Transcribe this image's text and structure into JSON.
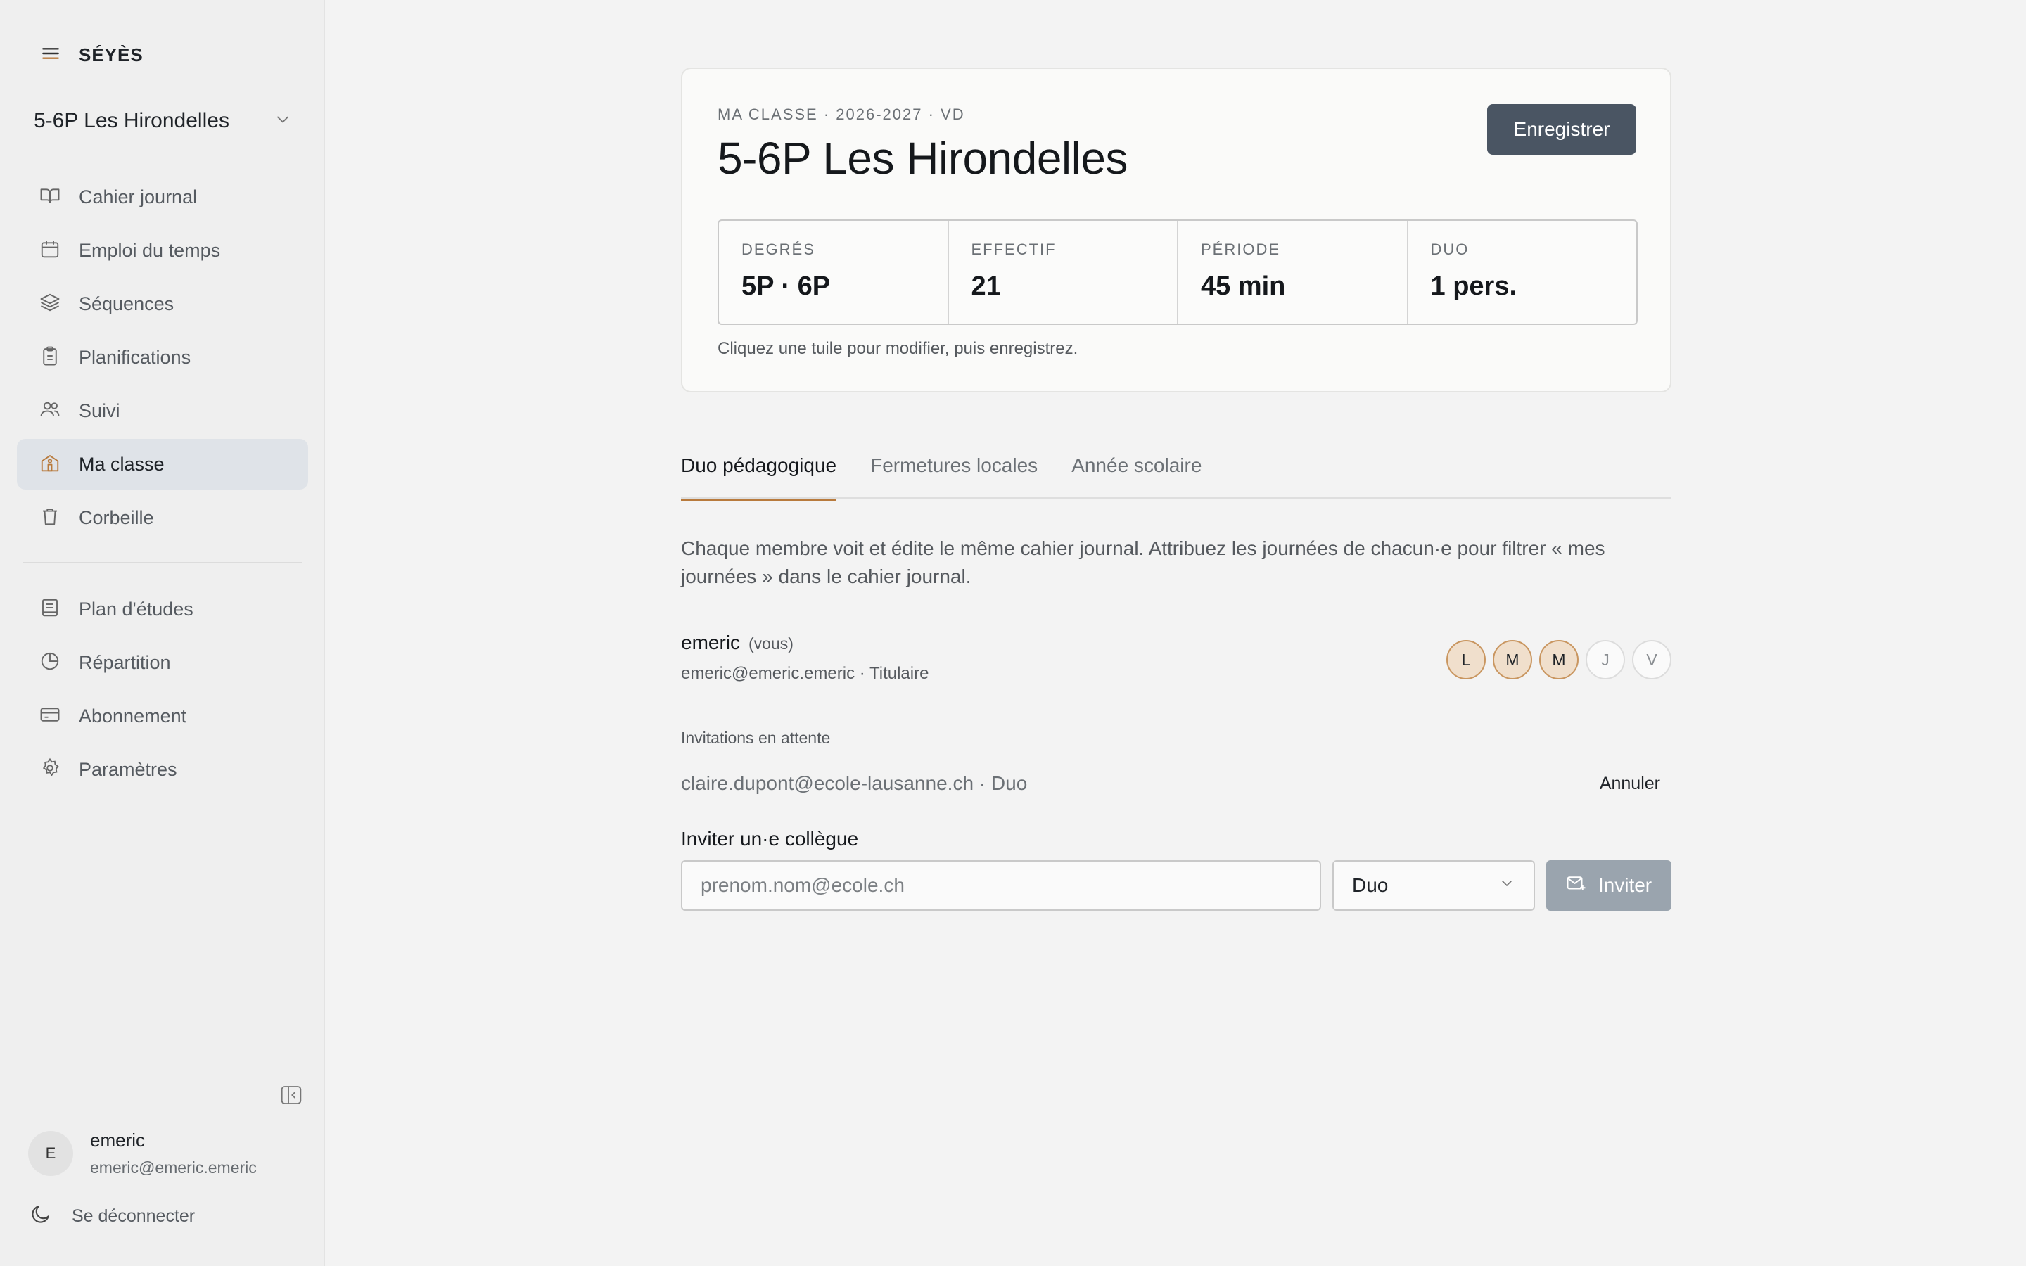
{
  "brand": {
    "name": "SÉYÈS",
    "menu_icon": "menu-icon"
  },
  "class_selector": {
    "value": "5-6P Les Hirondelles",
    "icon": "chevron-down-icon"
  },
  "nav_primary": [
    {
      "label": "Cahier journal",
      "icon": "book-open-icon",
      "active": false
    },
    {
      "label": "Emploi du temps",
      "icon": "calendar-icon",
      "active": false
    },
    {
      "label": "Séquences",
      "icon": "layers-icon",
      "active": false
    },
    {
      "label": "Planifications",
      "icon": "clipboard-icon",
      "active": false
    },
    {
      "label": "Suivi",
      "icon": "users-icon",
      "active": false
    },
    {
      "label": "Ma classe",
      "icon": "school-icon",
      "active": true
    },
    {
      "label": "Corbeille",
      "icon": "trash-icon",
      "active": false
    }
  ],
  "nav_secondary": [
    {
      "label": "Plan d'études",
      "icon": "notebook-icon"
    },
    {
      "label": "Répartition",
      "icon": "pie-chart-icon"
    },
    {
      "label": "Abonnement",
      "icon": "credit-card-icon"
    },
    {
      "label": "Paramètres",
      "icon": "gear-icon"
    }
  ],
  "user": {
    "initial": "E",
    "name": "emeric",
    "email": "emeric@emeric.emeric"
  },
  "logout": {
    "label": "Se déconnecter",
    "icon": "moon-icon"
  },
  "class_card": {
    "eyebrow": "MA CLASSE · 2026-2027 · VD",
    "title": "5-6P Les Hirondelles",
    "save_label": "Enregistrer",
    "tiles": [
      {
        "label": "DEGRÉS",
        "value": "5P · 6P"
      },
      {
        "label": "EFFECTIF",
        "value": "21"
      },
      {
        "label": "PÉRIODE",
        "value": "45 min"
      },
      {
        "label": "DUO",
        "value": "1 pers."
      }
    ],
    "hint": "Cliquez une tuile pour modifier, puis enregistrez."
  },
  "tabs": [
    {
      "label": "Duo pédagogique",
      "active": true
    },
    {
      "label": "Fermetures locales",
      "active": false
    },
    {
      "label": "Année scolaire",
      "active": false
    }
  ],
  "duo": {
    "description": "Chaque membre voit et édite le même cahier journal. Attribuez les journées de chacun·e pour filtrer « mes journées » dans le cahier journal.",
    "member": {
      "name": "emeric",
      "you_tag": "(vous)",
      "meta": "emeric@emeric.emeric · Titulaire",
      "days": [
        {
          "label": "L",
          "selected": true
        },
        {
          "label": "M",
          "selected": true
        },
        {
          "label": "M",
          "selected": true
        },
        {
          "label": "J",
          "selected": false
        },
        {
          "label": "V",
          "selected": false
        }
      ]
    },
    "pending_label": "Invitations en attente",
    "pending": [
      {
        "text": "claire.dupont@ecole-lausanne.ch · Duo",
        "cancel_label": "Annuler"
      }
    ],
    "invite": {
      "label": "Inviter un·e collègue",
      "placeholder": "prenom.nom@ecole.ch",
      "role": "Duo",
      "button_label": "Inviter",
      "button_icon": "mail-icon"
    }
  },
  "colors": {
    "accent": "#b87a3c",
    "primary_button": "#4a5563",
    "disabled_button": "#9aa4ae",
    "active_nav": "#dfe3e8"
  }
}
